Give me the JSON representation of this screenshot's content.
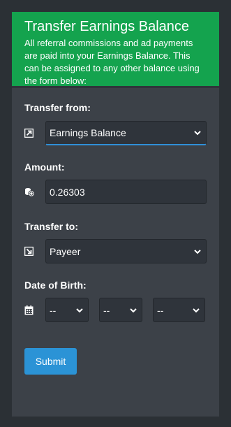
{
  "header": {
    "title": "Transfer Earnings Balance",
    "description": "All referral commissions and ad payments are paid into your Earnings Balance. This can be assigned to any other balance using the form below:"
  },
  "form": {
    "transfer_from": {
      "label": "Transfer from:",
      "icon": "external-link-icon",
      "selected": "Earnings Balance"
    },
    "amount": {
      "label": "Amount:",
      "icon": "coins-icon",
      "value": "0.26303"
    },
    "transfer_to": {
      "label": "Transfer to:",
      "icon": "arrow-down-right-icon",
      "selected": "Payeer"
    },
    "dob": {
      "label": "Date of Birth:",
      "icon": "calendar-icon",
      "day": "--",
      "month": "--",
      "year": "--"
    },
    "submit_label": "Submit"
  },
  "colors": {
    "header_bg": "#14a34e",
    "card_bg": "#3c4148",
    "page_bg": "#2b3035",
    "input_bg": "#2f343b",
    "accent": "#2b93d6"
  }
}
